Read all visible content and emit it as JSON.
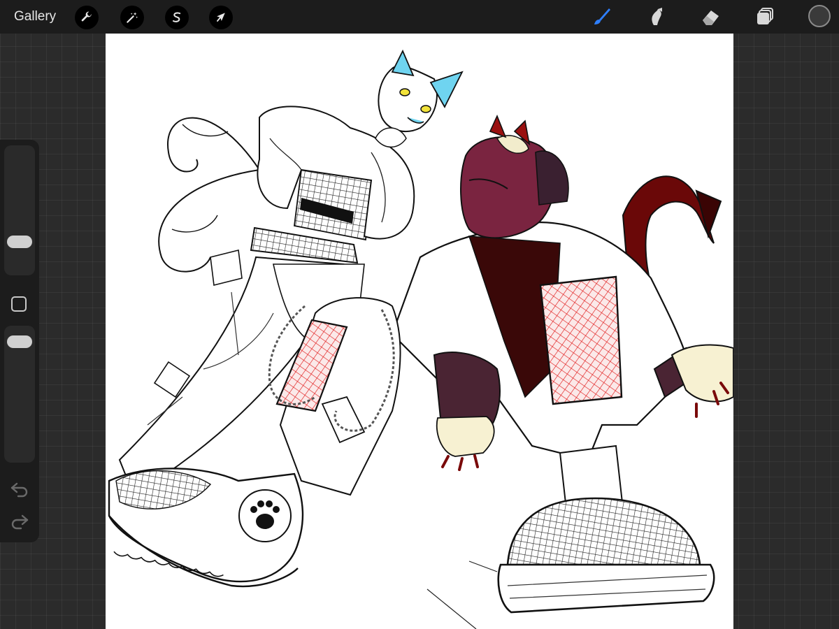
{
  "topbar": {
    "gallery_label": "Gallery",
    "left_tools": [
      {
        "name": "actions",
        "icon": "wrench-icon"
      },
      {
        "name": "adjustments",
        "icon": "magic-wand-icon"
      },
      {
        "name": "selection",
        "icon": "selection-s-icon"
      },
      {
        "name": "transform",
        "icon": "arrow-cursor-icon"
      }
    ],
    "right_tools": [
      {
        "name": "brush",
        "icon": "brush-icon",
        "active": true
      },
      {
        "name": "smudge",
        "icon": "smudge-icon",
        "active": false
      },
      {
        "name": "eraser",
        "icon": "eraser-icon",
        "active": false
      },
      {
        "name": "layers",
        "icon": "layers-icon",
        "active": false
      }
    ],
    "current_color": "#3a3a3a"
  },
  "colors": {
    "accent": "#2e7fff",
    "topbar_bg": "#1c1c1c",
    "workspace_bg": "#2b2b2b",
    "canvas_bg": "#ffffff"
  },
  "sidebar": {
    "icons": [
      "brush-size-slider",
      "modify-square-icon",
      "opacity-slider",
      "undo-icon",
      "redo-icon"
    ]
  },
  "canvas": {
    "content": "drawing-in-progress"
  }
}
